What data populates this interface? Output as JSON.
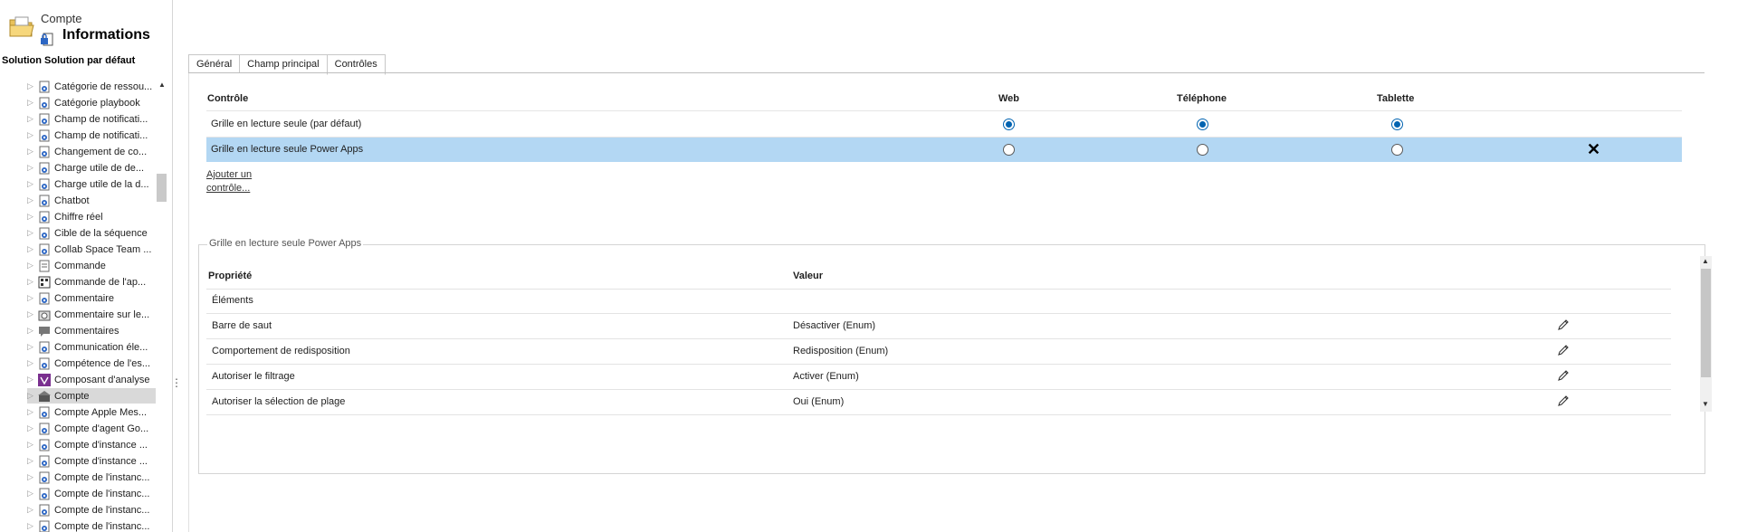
{
  "header": {
    "entity": "Compte",
    "title": "Informations",
    "solution": "Solution Solution par défaut"
  },
  "tree": [
    {
      "label": "Catégorie de ressou...",
      "icon": "gear-entity-icon"
    },
    {
      "label": "Catégorie playbook",
      "icon": "gear-entity-icon"
    },
    {
      "label": "Champ de notificati...",
      "icon": "gear-entity-icon"
    },
    {
      "label": "Champ de notificati...",
      "icon": "gear-entity-icon"
    },
    {
      "label": "Changement de co...",
      "icon": "gear-entity-icon"
    },
    {
      "label": "Charge utile de de...",
      "icon": "gear-entity-icon"
    },
    {
      "label": "Charge utile de la d...",
      "icon": "gear-entity-icon"
    },
    {
      "label": "Chatbot",
      "icon": "gear-entity-icon"
    },
    {
      "label": "Chiffre réel",
      "icon": "gear-entity-icon"
    },
    {
      "label": "Cible de la séquence",
      "icon": "gear-entity-icon"
    },
    {
      "label": "Collab Space Team ...",
      "icon": "gear-entity-icon"
    },
    {
      "label": "Commande",
      "icon": "document-entity-icon"
    },
    {
      "label": "Commande de l'ap...",
      "icon": "grid-entity-icon"
    },
    {
      "label": "Commentaire",
      "icon": "gear-entity-icon"
    },
    {
      "label": "Commentaire sur le...",
      "icon": "camera-entity-icon"
    },
    {
      "label": "Commentaires",
      "icon": "comment-entity-icon"
    },
    {
      "label": "Communication éle...",
      "icon": "gear-entity-icon"
    },
    {
      "label": "Compétence de l'es...",
      "icon": "gear-entity-icon"
    },
    {
      "label": "Composant d'analyse",
      "icon": "analysis-entity-icon"
    },
    {
      "label": "Compte",
      "icon": "account-entity-icon"
    },
    {
      "label": "Compte Apple Mes...",
      "icon": "gear-entity-icon"
    },
    {
      "label": "Compte d'agent Go...",
      "icon": "gear-entity-icon"
    },
    {
      "label": "Compte d'instance ...",
      "icon": "gear-entity-icon"
    },
    {
      "label": "Compte d'instance ...",
      "icon": "gear-entity-icon"
    },
    {
      "label": "Compte de l'instanc...",
      "icon": "gear-entity-icon"
    },
    {
      "label": "Compte de l'instanc...",
      "icon": "gear-entity-icon"
    },
    {
      "label": "Compte de l'instanc...",
      "icon": "gear-entity-icon"
    },
    {
      "label": "Compte de l'instanc...",
      "icon": "gear-entity-icon"
    }
  ],
  "selected_tree_item": "Compte",
  "tabs": [
    {
      "label": "Général",
      "active": false
    },
    {
      "label": "Champ principal",
      "active": false
    },
    {
      "label": "Contrôles",
      "active": true
    }
  ],
  "controls": {
    "headers": {
      "control": "Contrôle",
      "web": "Web",
      "phone": "Téléphone",
      "tablet": "Tablette"
    },
    "rows": [
      {
        "name": "Grille en lecture seule (par défaut)",
        "web": true,
        "phone": true,
        "tablet": true,
        "selected": false
      },
      {
        "name": "Grille en lecture seule Power Apps",
        "web": false,
        "phone": false,
        "tablet": false,
        "selected": true
      }
    ],
    "add_link": "Ajouter un contrôle...",
    "remove_glyph": "✕"
  },
  "properties": {
    "group_title": "Grille en lecture seule Power Apps",
    "headers": {
      "property": "Propriété",
      "value": "Valeur"
    },
    "rows": [
      {
        "property": "Éléments",
        "value": "",
        "editable": false
      },
      {
        "property": "Barre de saut",
        "value": "Désactiver (Enum)",
        "editable": true
      },
      {
        "property": "Comportement de redisposition",
        "value": "Redisposition (Enum)",
        "editable": true
      },
      {
        "property": "Autoriser le filtrage",
        "value": "Activer (Enum)",
        "editable": true
      },
      {
        "property": "Autoriser la sélection de plage",
        "value": "Oui (Enum)",
        "editable": true
      }
    ]
  },
  "colors": {
    "selected_row": "#b3d7f3",
    "radio_checked": "#0063b1",
    "tree_selected": "#d9d9d9"
  }
}
